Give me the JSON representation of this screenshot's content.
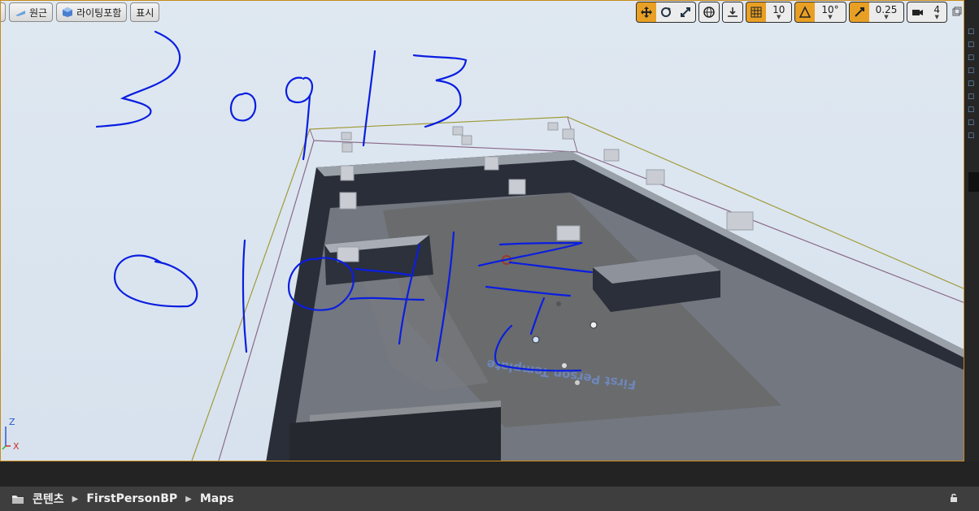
{
  "toolbar_left": {
    "perspective_label": "원근",
    "lighting_label": "라이팅포함",
    "show_label": "표시"
  },
  "toolbar_right": {
    "grid_snap_value": "10",
    "rotation_snap_value": "10°",
    "scale_snap_value": "0.25",
    "camera_speed_value": "4"
  },
  "viewport": {
    "floor_text": "First Person Template",
    "axis_z": "Z",
    "axis_x": "X"
  },
  "breadcrumb": {
    "items": [
      "콘텐츠",
      "FirstPersonBP",
      "Maps"
    ]
  },
  "colors": {
    "accent": "#e8a024",
    "viewport_border": "#c98a1a",
    "handwriting": "#0a1ee0"
  }
}
